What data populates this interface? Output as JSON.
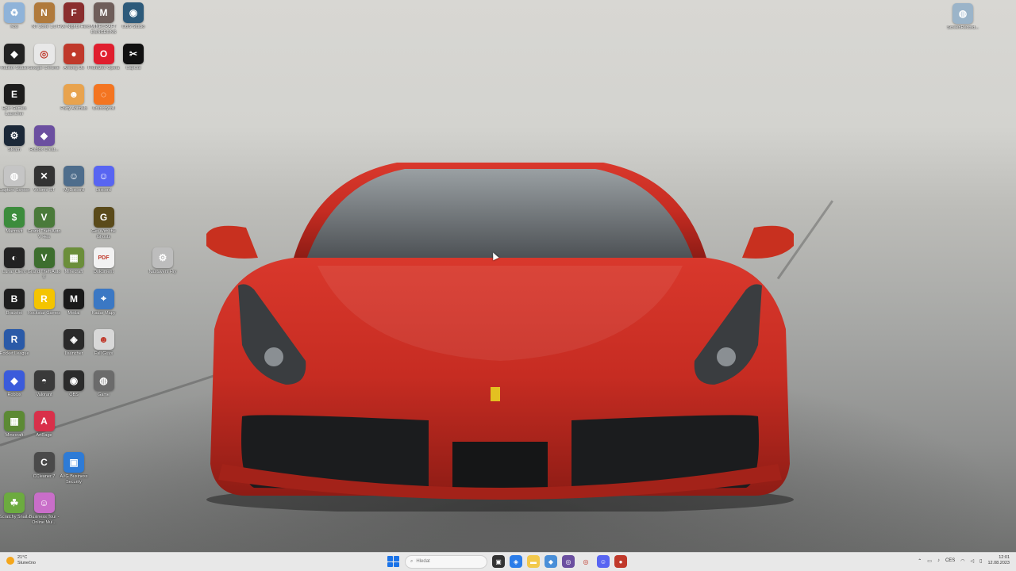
{
  "desktop_icons": [
    {
      "label": "Koš",
      "icon": "recycle-bin-icon",
      "color": "#8fb3d9",
      "glyph": "♻"
    },
    {
      "label": "NT Zone 1.0",
      "icon": "game-icon",
      "color": "#b07a3c",
      "glyph": "N"
    },
    {
      "label": "Five Nights Hero",
      "icon": "game-icon",
      "color": "#8a2e2e",
      "glyph": "F"
    },
    {
      "label": "MINECRAFT DUNGEONS",
      "icon": "game-icon",
      "color": "#6f5e5a",
      "glyph": "M"
    },
    {
      "label": "OBS Studio",
      "icon": "camera-icon",
      "color": "#2d5a7a",
      "glyph": "◉"
    },
    {
      "label": "Roblox Studio",
      "icon": "roblox-icon",
      "color": "#222222",
      "glyph": "◆"
    },
    {
      "label": "Google Chrome",
      "icon": "chrome-icon",
      "color": "#e8e8e8",
      "glyph": "◎"
    },
    {
      "label": "Among Us",
      "icon": "among-us-icon",
      "color": "#c0392b",
      "glyph": "●"
    },
    {
      "label": "Prohlížeč Opera",
      "icon": "opera-icon",
      "color": "#e01e2e",
      "glyph": "O"
    },
    {
      "label": "CapCut",
      "icon": "capcut-icon",
      "color": "#111111",
      "glyph": "✂"
    },
    {
      "label": "Epic Games Launcher",
      "icon": "epic-games-icon",
      "color": "#1c1c1c",
      "glyph": "E"
    },
    {
      "label": "Party Animals",
      "icon": "dog-icon",
      "color": "#e8a34e",
      "glyph": "☻"
    },
    {
      "label": "Crunchyroll",
      "icon": "crunchyroll-icon",
      "color": "#f47521",
      "glyph": "◌"
    },
    {
      "label": "Steam",
      "icon": "steam-icon",
      "color": "#1b2838",
      "glyph": "⚙"
    },
    {
      "label": "Roblox Creat...",
      "icon": "roblox-icon",
      "color": "#6b4fa0",
      "glyph": "◆"
    },
    {
      "label": "Capture Screen",
      "icon": "capture-icon",
      "color": "#c5c5c5",
      "glyph": "◍"
    },
    {
      "label": "Volume ST",
      "icon": "game-icon",
      "color": "#333333",
      "glyph": "✕"
    },
    {
      "label": "MyDiscord",
      "icon": "penguin-icon",
      "color": "#4e6d8c",
      "glyph": "☺"
    },
    {
      "label": "Discord",
      "icon": "discord-icon",
      "color": "#5865f2",
      "glyph": "☺"
    },
    {
      "label": "Macrovít",
      "icon": "macro-icon",
      "color": "#3c8c3c",
      "glyph": "$"
    },
    {
      "label": "Grand Theft Auto V Hes",
      "icon": "gta-icon",
      "color": "#4a7a3a",
      "glyph": "V"
    },
    {
      "label": "Get With the Ghosts",
      "icon": "game-icon",
      "color": "#5a4a1a",
      "glyph": "G"
    },
    {
      "label": "Lunar Client",
      "icon": "lunar-icon",
      "color": "#222222",
      "glyph": "◐"
    },
    {
      "label": "Grand Theft Auto V",
      "icon": "gta-icon",
      "color": "#3d6e2e",
      "glyph": "V"
    },
    {
      "label": "Minecraft",
      "icon": "minecraft-icon",
      "color": "#6b8e3a",
      "glyph": "▦"
    },
    {
      "label": "Dokument",
      "icon": "pdf-icon",
      "color": "#f2f2f2",
      "glyph": "PDF"
    },
    {
      "label": "Nastavení Hry",
      "icon": "settings-icon",
      "color": "#bdbdbd",
      "glyph": "⚙"
    },
    {
      "label": "Bracelet",
      "icon": "game-icon",
      "color": "#1e1e1e",
      "glyph": "B"
    },
    {
      "label": "Rockstar Games",
      "icon": "rockstar-icon",
      "color": "#f4c400",
      "glyph": "R"
    },
    {
      "label": "Medal",
      "icon": "medal-icon",
      "color": "#1a1a1a",
      "glyph": "M"
    },
    {
      "label": "Radar Mapy",
      "icon": "map-pin-icon",
      "color": "#3b78c4",
      "glyph": "⌖"
    },
    {
      "label": "Rocket League",
      "icon": "rocket-league-icon",
      "color": "#2a5aa8",
      "glyph": "R"
    },
    {
      "label": "Launcher",
      "icon": "launcher-icon",
      "color": "#2a2a2a",
      "glyph": "◈"
    },
    {
      "label": "Fall Guys",
      "icon": "fall-guys-icon",
      "color": "#d8d8d8",
      "glyph": "☻"
    },
    {
      "label": "Roblox",
      "icon": "roblox-icon",
      "color": "#3b5bdb",
      "glyph": "◆"
    },
    {
      "label": "Valorant",
      "icon": "game-icon",
      "color": "#3a3a3a",
      "glyph": "◓"
    },
    {
      "label": "OBS",
      "icon": "obs-icon",
      "color": "#2b2b2b",
      "glyph": "◉"
    },
    {
      "label": "Game",
      "icon": "game-icon",
      "color": "#6b6b6b",
      "glyph": "◍"
    },
    {
      "label": "Minecraft",
      "icon": "minecraft-icon",
      "color": "#5c8a34",
      "glyph": "▦"
    },
    {
      "label": "ArtRage",
      "icon": "app-icon",
      "color": "#d9304a",
      "glyph": "A"
    },
    {
      "label": "CCleaner 7",
      "icon": "ccleaner-icon",
      "color": "#4a4a4a",
      "glyph": "C"
    },
    {
      "label": "AVG Business Security",
      "icon": "avg-icon",
      "color": "#2e7bd6",
      "glyph": "▣"
    },
    {
      "label": "Scratchy Snails",
      "icon": "game-icon",
      "color": "#6cab3f",
      "glyph": "☘"
    },
    {
      "label": "Business Tour - Online Mul...",
      "icon": "game-icon",
      "color": "#c96ec9",
      "glyph": "☺"
    },
    {
      "label": "ScreenRecord...",
      "icon": "screen-record-icon",
      "color": "#9bb4c9",
      "glyph": "◍"
    }
  ],
  "taskbar": {
    "weather_temp": "21°C",
    "weather_desc": "Slunečno",
    "search_placeholder": "Hledat",
    "apps": [
      {
        "icon": "task-view-icon",
        "color": "#333333",
        "glyph": "▣"
      },
      {
        "icon": "widgets-icon",
        "color": "#2b7de9",
        "glyph": "◈"
      },
      {
        "icon": "file-explorer-icon",
        "color": "#f2c94c",
        "glyph": "▬"
      },
      {
        "icon": "store-icon",
        "color": "#4a8fd8",
        "glyph": "◆"
      },
      {
        "icon": "browser-icon",
        "color": "#6b4fa0",
        "glyph": "◎"
      },
      {
        "icon": "chrome-icon",
        "color": "#e8e8e8",
        "glyph": "◎"
      },
      {
        "icon": "discord-icon",
        "color": "#5865f2",
        "glyph": "☺"
      },
      {
        "icon": "app-icon",
        "color": "#c0392b",
        "glyph": "●"
      }
    ],
    "tray_language": "CES",
    "clock_time": "12:01",
    "clock_date": "12.08.2023"
  }
}
